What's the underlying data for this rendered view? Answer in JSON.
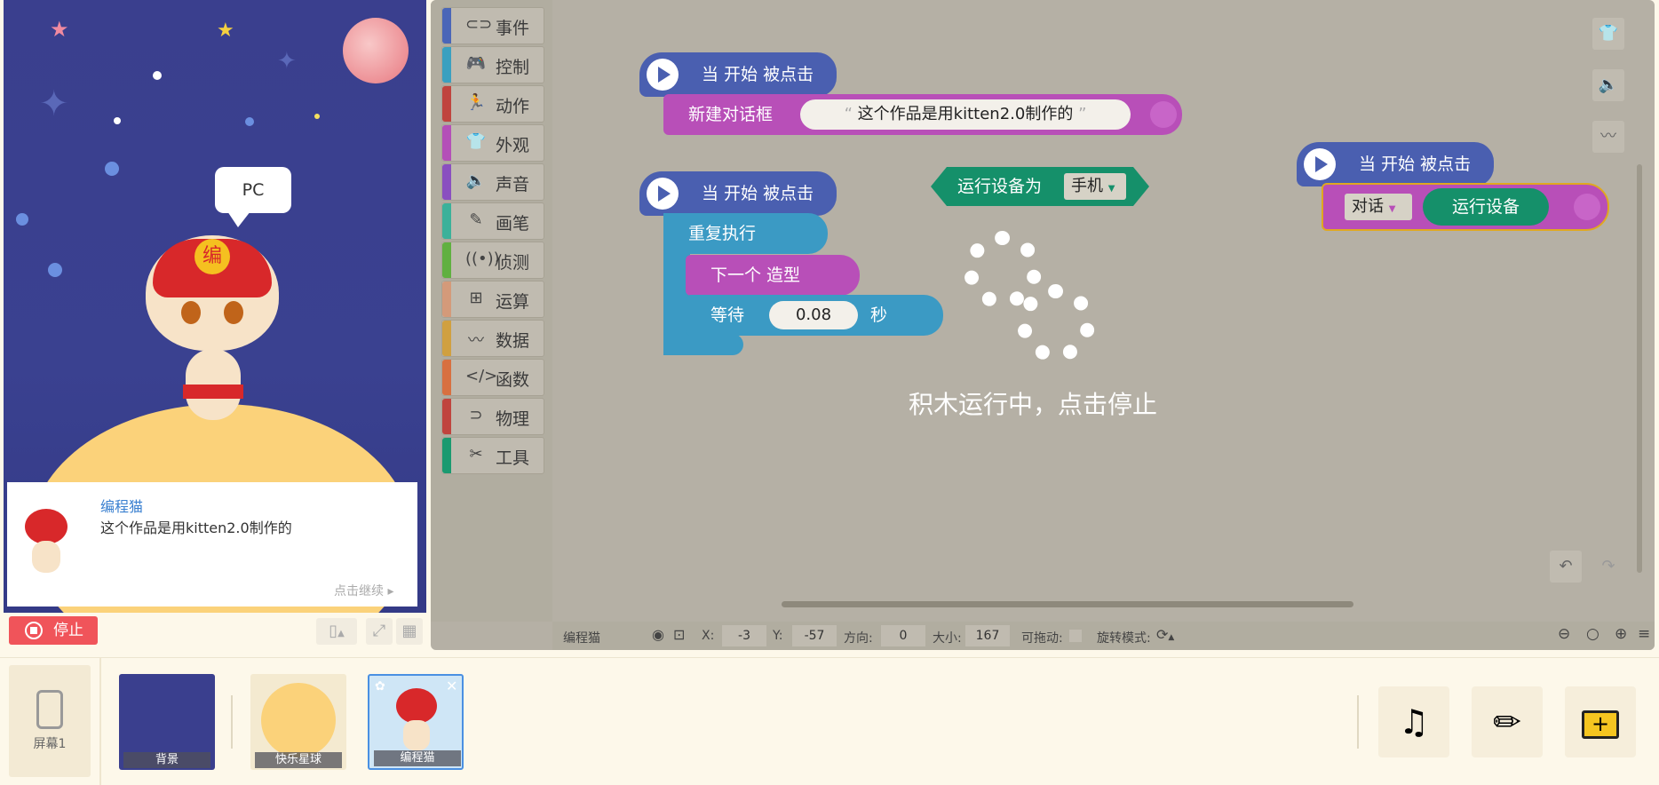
{
  "stage": {
    "bubble": "PC",
    "dialog_name": "编程猫",
    "dialog_text": "这个作品是用kitten2.0制作的",
    "continue": "点击继续",
    "stop": "停止"
  },
  "palette": [
    {
      "label": "事件",
      "color": "#4a66b8",
      "icon": "toggle-icon",
      "glyph": "⊂⊃"
    },
    {
      "label": "控制",
      "color": "#3aa0c0",
      "icon": "gamepad-icon",
      "glyph": "🎮"
    },
    {
      "label": "动作",
      "color": "#c0443e",
      "icon": "run-icon",
      "glyph": "🏃"
    },
    {
      "label": "外观",
      "color": "#b44fb8",
      "icon": "shirt-icon",
      "glyph": "👕"
    },
    {
      "label": "声音",
      "color": "#8a4fc0",
      "icon": "speaker-icon",
      "glyph": "🔈"
    },
    {
      "label": "画笔",
      "color": "#3bb19a",
      "icon": "pencil-icon",
      "glyph": "✎"
    },
    {
      "label": "侦测",
      "color": "#60b040",
      "icon": "signal-icon",
      "glyph": "((•))"
    },
    {
      "label": "运算",
      "color": "#d49a7a",
      "icon": "calculator-icon",
      "glyph": "⊞"
    },
    {
      "label": "数据",
      "color": "#d0a040",
      "icon": "chart-line-icon",
      "glyph": "〰"
    },
    {
      "label": "函数",
      "color": "#d87040",
      "icon": "code-icon",
      "glyph": "</>"
    },
    {
      "label": "物理",
      "color": "#c0443e",
      "icon": "magnet-icon",
      "glyph": "⊃"
    },
    {
      "label": "工具",
      "color": "#1a9a70",
      "icon": "tools-icon",
      "glyph": "✂"
    }
  ],
  "blocks": {
    "hat": "当 开始 被点击",
    "new_dialog": "新建对话框",
    "dialog_value": "这个作品是用kitten2.0制作的",
    "quote_open": "“",
    "quote_close": "”",
    "repeat": "重复执行",
    "next_costume": "下一个 造型",
    "wait": "等待",
    "wait_value": "0.08",
    "seconds": "秒",
    "device_label": "运行设备为",
    "device_value": "手机",
    "say": "对话",
    "run_device": "运行设备",
    "running": "积木运行中，点击停止"
  },
  "status": {
    "sprite": "编程猫",
    "x_label": "X:",
    "x": "-3",
    "y_label": "Y:",
    "y": "-57",
    "dir_label": "方向:",
    "dir": "0",
    "size_label": "大小:",
    "size": "167",
    "drag_label": "可拖动:",
    "rot_label": "旋转模式:"
  },
  "bottom": {
    "screen": "屏幕1",
    "sprites": [
      {
        "label": "背景"
      },
      {
        "label": "快乐星球"
      },
      {
        "label": "编程猫"
      }
    ]
  }
}
